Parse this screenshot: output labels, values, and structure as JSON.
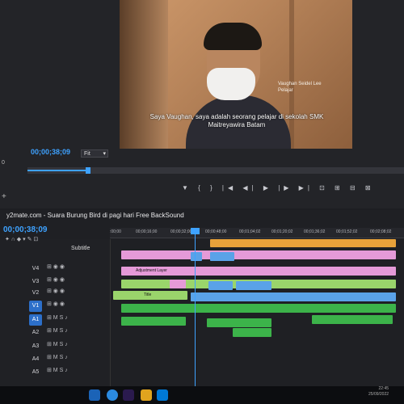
{
  "video": {
    "caption_line1": "Saya Vaughan, saya adalah seorang pelajar di sekolah SMK",
    "caption_line2": "Maitreyawira Batam",
    "name_tag_name": "Vaughan Seidel Lee",
    "name_tag_role": "Pelajar"
  },
  "program_monitor": {
    "timecode": "00;00;38;09",
    "fit_label": "Fit",
    "transport_glyphs": "▼ { } |◀ ◀| ▶ |▶ ▶| ⊡ ⊞ ⊟ ⊠"
  },
  "timeline": {
    "sequence_title": "y2mate.com - Suara Burung Bird di pagi hari Free BackSound",
    "current_timecode": "00;00;38;09",
    "ruler_ticks": [
      ":00;00",
      "00;00;16;00",
      "00;00;32;00",
      "00;00;48;00",
      "00;01;04;02",
      "00;01;20;02",
      "00;01;36;02",
      "00;01;52;02",
      "00;02;08;02"
    ],
    "subtitle_label": "Subtitle",
    "tracks": [
      {
        "label": "V4",
        "active": false
      },
      {
        "label": "V3",
        "active": false
      },
      {
        "label": "V2",
        "active": false
      },
      {
        "label": "V1",
        "active": true
      },
      {
        "label": "A1",
        "active": true
      },
      {
        "label": "A2",
        "active": false
      },
      {
        "label": "A3",
        "active": false
      },
      {
        "label": "A4",
        "active": false
      },
      {
        "label": "A5",
        "active": false
      }
    ],
    "clip_labels": {
      "adjustment_layer": "Adjustment Layer",
      "title_1": "Title",
      "title_2": "Title",
      "title_3": "Title"
    }
  },
  "taskbar": {
    "time": "22:45",
    "date": "25/09/2022"
  },
  "colors": {
    "accent": "#3ea2ff",
    "clip_pink": "#e59ad8",
    "clip_blue": "#5aa2e8",
    "clip_green": "#3cb34a",
    "clip_orange": "#e8a23a",
    "clip_light_green": "#9ad46b"
  }
}
